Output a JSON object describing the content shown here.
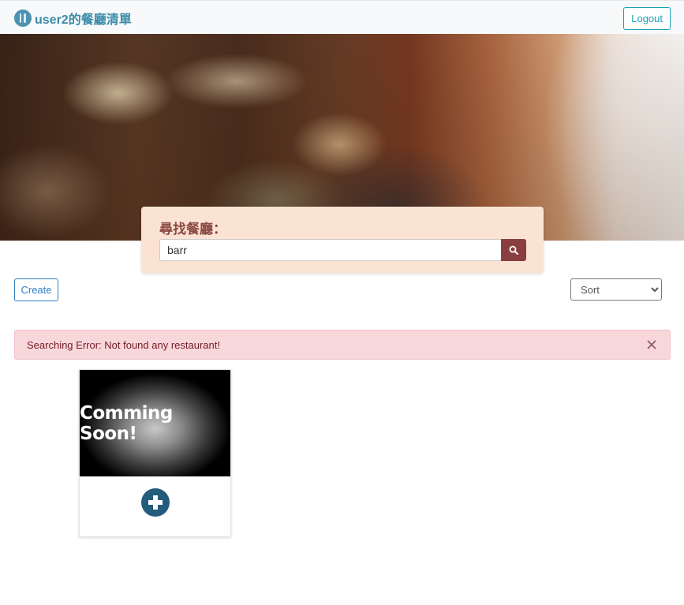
{
  "navbar": {
    "brand_icon": "utensils-icon",
    "brand_title": "user2的餐廳清單",
    "logout_label": "Logout"
  },
  "search": {
    "label": "尋找餐廳：",
    "value": "barr",
    "button_icon": "search-icon"
  },
  "toolbar": {
    "create_label": "Create",
    "sort_selected": "Sort"
  },
  "alert": {
    "message": "Searching Error: Not found any restaurant!",
    "close_icon": "close-icon"
  },
  "card": {
    "image_text": "Comming Soon!",
    "add_icon": "plus-circle-icon"
  },
  "colors": {
    "brand": "#3a8ca8",
    "accent": "#17a2b8",
    "search_button": "#8b3e3f",
    "search_card": "#fbe3d3",
    "alert_bg": "#f8d7da",
    "add_button": "#235c7c"
  }
}
